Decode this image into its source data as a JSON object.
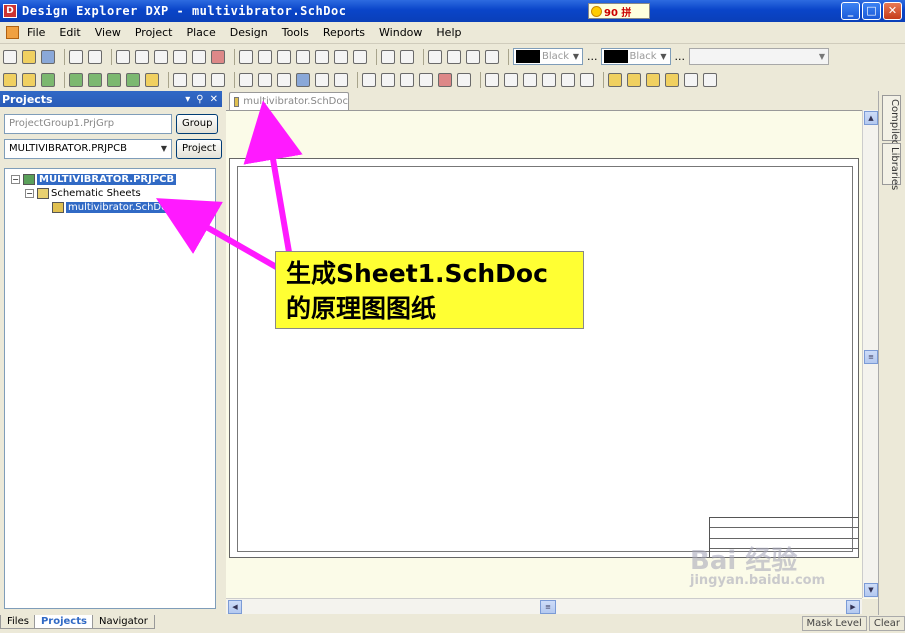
{
  "window": {
    "title": "Design Explorer DXP - multivibrator.SchDoc",
    "ime_text": "90 拼"
  },
  "menu": [
    "File",
    "Edit",
    "View",
    "Project",
    "Place",
    "Design",
    "Tools",
    "Reports",
    "Window",
    "Help"
  ],
  "toolbar": {
    "color1": "Black",
    "color2": "Black",
    "ellipsis": "..."
  },
  "panel": {
    "title": "Projects",
    "group_field": "ProjectGroup1.PrjGrp",
    "group_button": "Group",
    "project_select": "MULTIVIBRATOR.PRJPCB",
    "project_button": "Project",
    "tree": {
      "root": "MULTIVIBRATOR.PRJPCB",
      "folder": "Schematic Sheets",
      "doc": "multivibrator.SchDoc"
    },
    "tabs": [
      "Files",
      "Projects",
      "Navigator"
    ]
  },
  "document": {
    "tab": "multivibrator.SchDoc"
  },
  "side_tabs": [
    "Compiled",
    "Libraries"
  ],
  "status": {
    "mask_level": "Mask Level",
    "clear": "Clear"
  },
  "annotation": {
    "line1": "生成Sheet1.SchDoc",
    "line2": "的原理图图纸",
    "color": "#ffff33",
    "arrow_color": "#ff1aff"
  },
  "watermark": {
    "brand": "Bai 经验",
    "url": "jingyan.baidu.com"
  }
}
